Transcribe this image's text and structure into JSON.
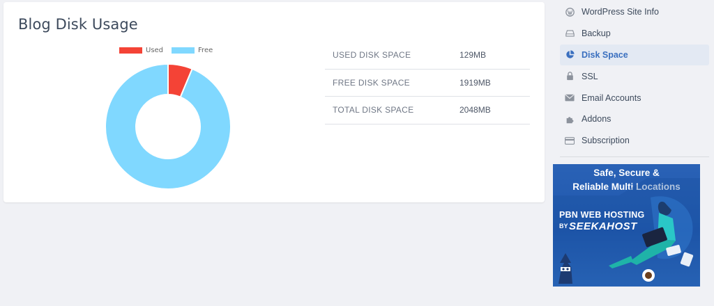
{
  "card": {
    "title": "Blog Disk Usage"
  },
  "chart_data": {
    "type": "pie",
    "categories": [
      "Used",
      "Free"
    ],
    "values": [
      129,
      1919
    ],
    "colors": [
      "#f44336",
      "#80d8ff"
    ],
    "legend_position": "top"
  },
  "stats": [
    {
      "label": "USED DISK SPACE",
      "value": "129MB"
    },
    {
      "label": "FREE DISK SPACE",
      "value": "1919MB"
    },
    {
      "label": "TOTAL DISK SPACE",
      "value": "2048MB"
    }
  ],
  "sidebar": {
    "items": [
      {
        "label": "WordPress Site Info",
        "icon": "wordpress-icon"
      },
      {
        "label": "Backup",
        "icon": "backup-icon"
      },
      {
        "label": "Disk Space",
        "icon": "pie-chart-icon",
        "active": true
      },
      {
        "label": "SSL",
        "icon": "lock-icon"
      },
      {
        "label": "Email Accounts",
        "icon": "envelope-icon"
      },
      {
        "label": "Addons",
        "icon": "puzzle-icon"
      },
      {
        "label": "Subscription",
        "icon": "credit-card-icon"
      }
    ]
  },
  "ad": {
    "headline_line1": "Safe, Secure &",
    "headline_line2": "Reliable Multi Locations",
    "brand_line1": "PBN WEB HOSTING",
    "brand_by": "BY",
    "brand_name": "SEEKAHOST"
  },
  "colors": {
    "accent": "#3a6fbf",
    "active_bg": "#e3e9f3",
    "used": "#f44336",
    "free": "#80d8ff"
  }
}
